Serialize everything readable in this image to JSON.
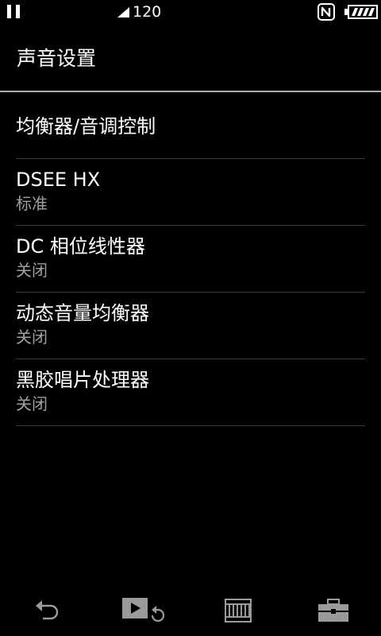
{
  "status_bar": {
    "volume": "120",
    "icons": [
      "pause-icon",
      "signal-icon",
      "nfc-icon",
      "battery-icon"
    ]
  },
  "header": {
    "title": "声音设置"
  },
  "settings": [
    {
      "label": "均衡器/音调控制",
      "value": ""
    },
    {
      "label": "DSEE HX",
      "value": "标准"
    },
    {
      "label": "DC 相位线性器",
      "value": "关闭"
    },
    {
      "label": "动态音量均衡器",
      "value": "关闭"
    },
    {
      "label": "黑胶唱片处理器",
      "value": "关闭"
    }
  ],
  "bottom_bar": {
    "icons": [
      "back-icon",
      "now-playing-icon",
      "library-icon",
      "toolbox-icon"
    ]
  },
  "colors": {
    "background": "#000000",
    "text_primary": "#ffffff",
    "text_secondary": "#a0a0a0",
    "divider": "#3c3c3c",
    "title_divider": "#b0b0b0",
    "icon_gray": "#9a9a9a"
  }
}
